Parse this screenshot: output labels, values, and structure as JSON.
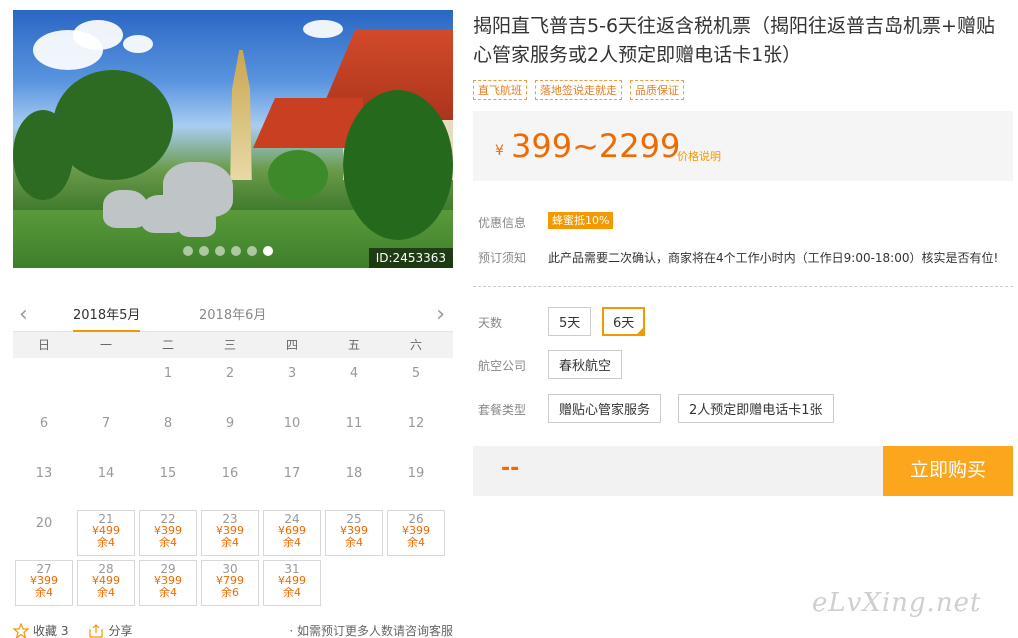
{
  "product": {
    "title": "揭阳直飞普吉5-6天往返含税机票（揭阳往返普吉岛机票+赠贴心管家服务或2人预定即赠电话卡1张）",
    "tags": [
      "直飞航班",
      "落地签说走就走",
      "品质保证"
    ],
    "image_id": "ID:2453363",
    "price_currency": "¥",
    "price_range": "399~2299",
    "price_explain": "价格说明"
  },
  "info": {
    "discount_label": "优惠信息",
    "discount_badge": "蜂蜜抵10%",
    "notice_label": "预订须知",
    "notice_text": "此产品需要二次确认，商家将在4个工作小时内（工作日9:00-18:00）核实是否有位!"
  },
  "options": {
    "days_label": "天数",
    "days": [
      "5天",
      "6天"
    ],
    "days_selected": "6天",
    "airline_label": "航空公司",
    "airline": "春秋航空",
    "package_label": "套餐类型",
    "packages": [
      "赠贴心管家服务",
      "2人预定即赠电话卡1张"
    ]
  },
  "buy": {
    "price_placeholder": "--",
    "button": "立即购买"
  },
  "calendar": {
    "tabs": [
      "2018年5月",
      "2018年6月"
    ],
    "prev_arrow": "‹",
    "next_arrow": "›",
    "weekdays": [
      "日",
      "一",
      "二",
      "三",
      "四",
      "五",
      "六"
    ],
    "leading_blanks": 2,
    "days": [
      {
        "d": "1"
      },
      {
        "d": "2"
      },
      {
        "d": "3"
      },
      {
        "d": "4"
      },
      {
        "d": "5"
      },
      {
        "d": "6"
      },
      {
        "d": "7"
      },
      {
        "d": "8"
      },
      {
        "d": "9"
      },
      {
        "d": "10"
      },
      {
        "d": "11"
      },
      {
        "d": "12"
      },
      {
        "d": "13"
      },
      {
        "d": "14"
      },
      {
        "d": "15"
      },
      {
        "d": "16"
      },
      {
        "d": "17"
      },
      {
        "d": "18"
      },
      {
        "d": "19"
      },
      {
        "d": "20"
      },
      {
        "d": "21",
        "price": "¥499",
        "remain": "余4"
      },
      {
        "d": "22",
        "price": "¥399",
        "remain": "余4"
      },
      {
        "d": "23",
        "price": "¥399",
        "remain": "余4"
      },
      {
        "d": "24",
        "price": "¥699",
        "remain": "余4"
      },
      {
        "d": "25",
        "price": "¥399",
        "remain": "余4"
      },
      {
        "d": "26",
        "price": "¥399",
        "remain": "余4"
      },
      {
        "d": "27",
        "price": "¥399",
        "remain": "余4"
      },
      {
        "d": "28",
        "price": "¥499",
        "remain": "余4"
      },
      {
        "d": "29",
        "price": "¥399",
        "remain": "余4"
      },
      {
        "d": "30",
        "price": "¥799",
        "remain": "余6"
      },
      {
        "d": "31",
        "price": "¥499",
        "remain": "余4"
      }
    ]
  },
  "footer": {
    "fav_label": "收藏 3",
    "share_label": "分享",
    "note": "· 如需预订更多人数请咨询客服"
  },
  "watermark": "eLvXing.net",
  "colors": {
    "accent": "#f39800",
    "price": "#f06a00",
    "buy_button": "#fba61c"
  }
}
